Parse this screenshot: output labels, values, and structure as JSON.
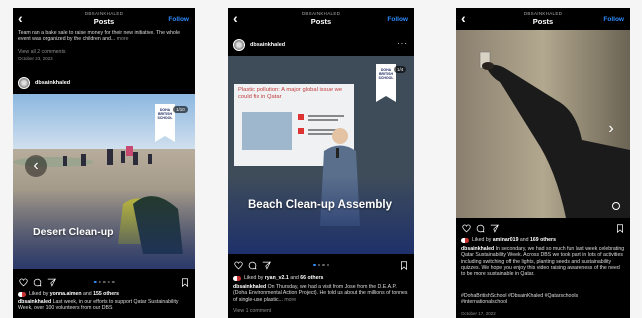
{
  "panel1": {
    "account": "DBSAINKHALED",
    "title": "Posts",
    "follow": "Follow",
    "prev_caption": "Team ran a bake sale to raise money for their new initiative. The whole event was organized by the children and...",
    "prev_more": "more",
    "prev_comments": "View all 2 comments",
    "prev_date": "October 23, 2022",
    "username": "dbsainkhaled",
    "image_title": "Desert Clean-up",
    "likes_user": "yonna.aimen",
    "likes_others": "155 others",
    "caption_user": "dbsainkhaled",
    "caption": "Last week, in our efforts to support Qatar Sustainability Week, over 100 volunteers from our DBS",
    "counter": "1/10"
  },
  "panel2": {
    "account": "DBSAINKHALED",
    "title": "Posts",
    "follow": "Follow",
    "username": "dbsainkhaled",
    "slide_title": "Plastic pollution: A major global issue we could fix in Qatar",
    "image_title": "Beach Clean-up Assembly",
    "likes_user": "ryan_v2.1",
    "likes_others": "66 others",
    "caption_user": "dbsainkhaled",
    "caption": "On Thursday, we had a visit from Jose from the D.E.A.P. (Doha Environmental Action Project). He told us about the millions of tonnes of single-use plastic...",
    "caption_more": "more",
    "comments": "View 1 comment",
    "counter": "1/4"
  },
  "panel3": {
    "account": "DBSAINKHALED",
    "title": "Posts",
    "follow": "Follow",
    "likes_user": "aminar019",
    "likes_others": "169 others",
    "caption_user": "dbsainkhaled",
    "caption": "In secondary, we had so much fun last week celebrating Qatar Sustainability Week. Across DBS we took part in lots of activities including switching off the lights, planting seeds and sustainability quizzes. We hope you enjoy this video raising awareness of the need to be more sustainable in Qatar.",
    "hashtags": "#DohaBritishSchool #DbsainKhaled #Qatarschools #internationalschool",
    "date": "October 17, 2022"
  },
  "common": {
    "liked_by": "Liked by",
    "and": "and",
    "badge": "DOHA BRITISH SCHOOL",
    "icons": [
      "heart-icon",
      "comment-icon",
      "share-icon",
      "bookmark-icon",
      "chevron-left-icon",
      "chevron-right-icon"
    ],
    "accent": "#2f8cff",
    "overlay_blue": "#1c2f6b"
  }
}
